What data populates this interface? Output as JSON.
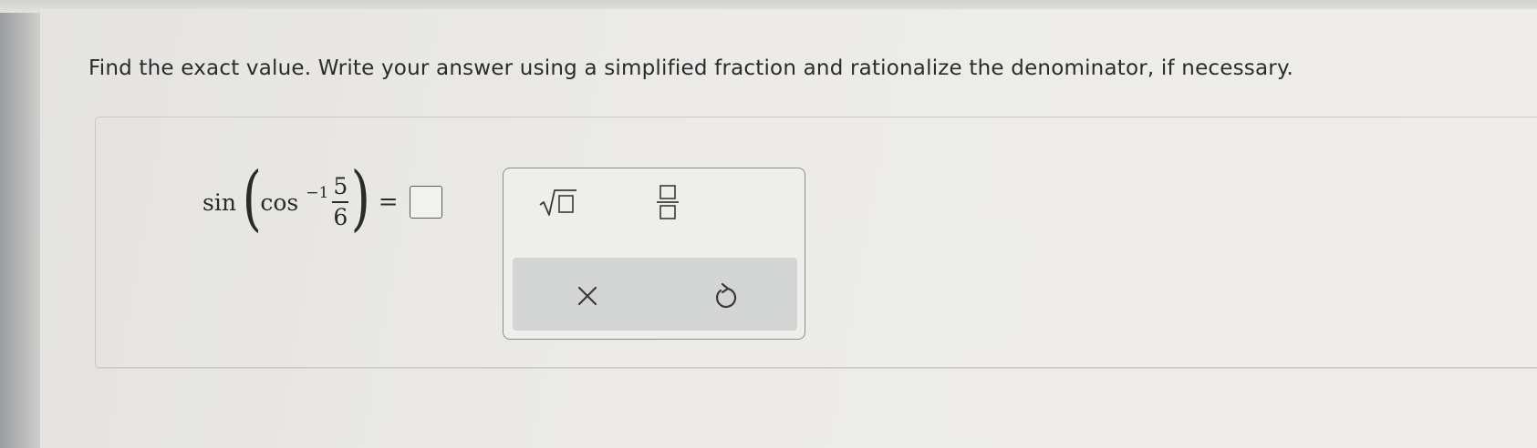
{
  "instructions": "Find the exact value. Write your answer using a simplified fraction and rationalize the denominator, if necessary.",
  "equation": {
    "outer_function": "sin",
    "inner_function": "cos",
    "exponent": "−1",
    "numerator": "5",
    "denominator": "6",
    "equals": "=",
    "answer_value": ""
  },
  "keypad": {
    "keys": [
      {
        "name": "square-root",
        "icon": "sqrt-template-icon"
      },
      {
        "name": "fraction",
        "icon": "fraction-template-icon"
      }
    ],
    "actions": [
      {
        "name": "clear",
        "icon": "x-icon"
      },
      {
        "name": "undo",
        "icon": "undo-icon"
      }
    ]
  }
}
